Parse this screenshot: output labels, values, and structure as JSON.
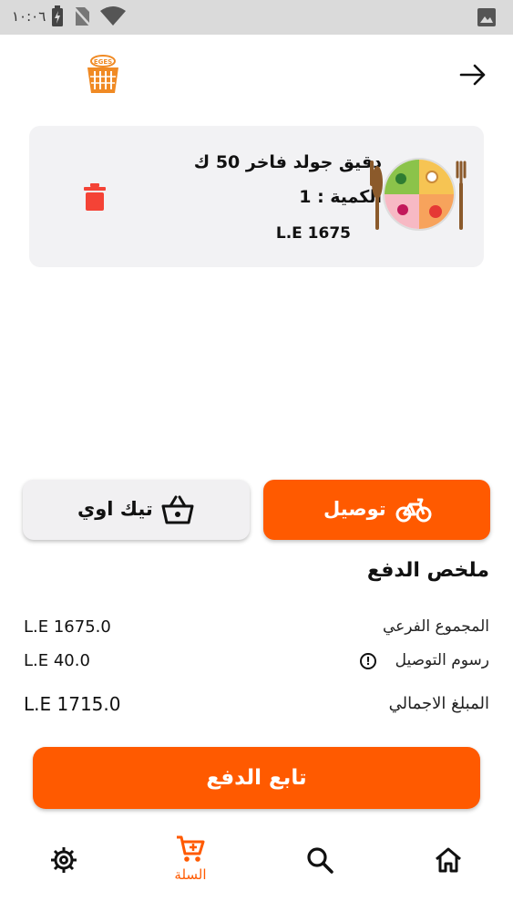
{
  "status_bar": {
    "time": "١٠:٠٦"
  },
  "cart": {
    "items": [
      {
        "name": "دقيق جولد فاخر 50 ك",
        "quantity_text": "الكمية : 1",
        "price": "L.E 1675"
      }
    ]
  },
  "order_type": {
    "delivery_label": "توصيل",
    "takeaway_label": "تيك اوي"
  },
  "summary": {
    "title": "ملخص الدفع",
    "subtotal_label": "المجموع الفرعي",
    "subtotal_value": "L.E 1675.0",
    "delivery_fee_label": "رسوم التوصيل",
    "delivery_fee_value": "L.E 40.0",
    "total_label": "المبلغ الاجمالي",
    "total_value": "L.E 1715.0"
  },
  "checkout": {
    "label": "تابع الدفع"
  },
  "bottom_nav": {
    "items": [
      {
        "icon": "gear-icon",
        "label": ""
      },
      {
        "icon": "cart-icon",
        "label": "السلة"
      },
      {
        "icon": "search-icon",
        "label": ""
      },
      {
        "icon": "home-icon",
        "label": ""
      }
    ]
  },
  "colors": {
    "accent": "#ff5a00",
    "card_bg": "#f2f2f4",
    "delete": "#f44336"
  }
}
